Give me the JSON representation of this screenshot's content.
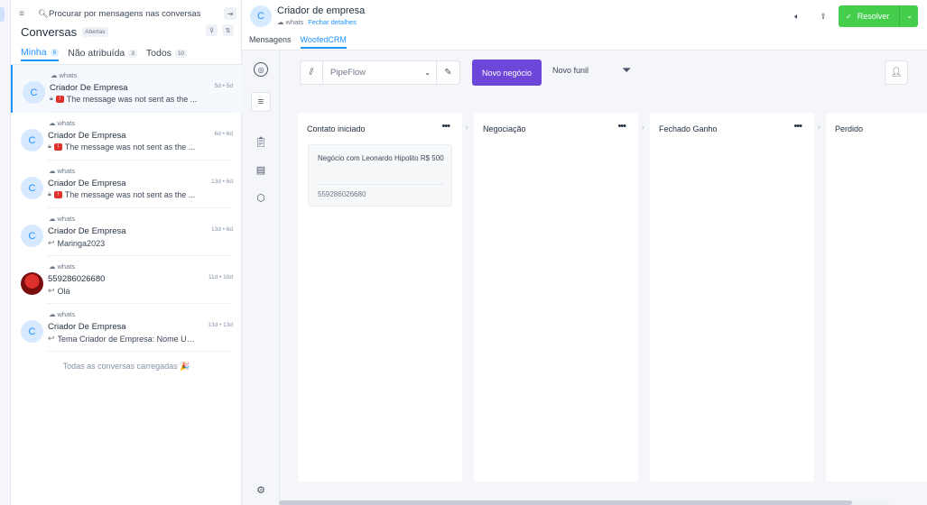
{
  "search": {
    "placeholder": "Procurar por mensagens nas conversas"
  },
  "conversations": {
    "title": "Conversas",
    "status_badge": "Abertas",
    "tabs": [
      {
        "label": "Minha",
        "count": "6"
      },
      {
        "label": "Não atribuída",
        "count": "3"
      },
      {
        "label": "Todos",
        "count": "10"
      }
    ],
    "items": [
      {
        "inbox": "whats",
        "name": "Criador De Empresa",
        "time": "5d • 5d",
        "message": "The message was not sent as the ...",
        "avatar": "C"
      },
      {
        "inbox": "whats",
        "name": "Criador De Empresa",
        "time": "6d • 6d",
        "message": "The message was not sent as the ...",
        "avatar": "C"
      },
      {
        "inbox": "whats",
        "name": "Criador De Empresa",
        "time": "13d • 6d",
        "message": "The message was not sent as the ...",
        "avatar": "C"
      },
      {
        "inbox": "whats",
        "name": "Criador De Empresa",
        "time": "13d • 6d",
        "message": "Maringa2023",
        "avatar": "C"
      },
      {
        "inbox": "whats",
        "name": "559286026680",
        "time": "11d • 10d",
        "message": "Olá",
        "avatar": ""
      },
      {
        "inbox": "whats",
        "name": "Criador De Empresa",
        "time": "13d • 13d",
        "message": "Tema Criador de Empresa: Nome Us...",
        "avatar": "C"
      }
    ],
    "loaded_message": "Todas as conversas carregadas 🎉"
  },
  "header": {
    "avatar": "C",
    "name": "Criador de empresa",
    "inbox": "whats",
    "details_link": "Fechar detalhes",
    "resolve_label": "Resolver"
  },
  "main_tabs": [
    {
      "label": "Mensagens"
    },
    {
      "label": "WoofedCRM"
    }
  ],
  "crm": {
    "pipeline": "PipeFlow",
    "new_deal_label": "Novo negócio",
    "new_funnel_label": "Novo funil",
    "stages": [
      {
        "name": "Contato iniciado",
        "deals": [
          {
            "title": "Negócio com Leonardo Hipolito R$ 500",
            "phone": "559286026680"
          }
        ]
      },
      {
        "name": "Negociação",
        "deals": []
      },
      {
        "name": "Fechado Ganho",
        "deals": []
      },
      {
        "name": "Perdido",
        "deals": []
      }
    ]
  },
  "colors": {
    "accent": "#1f93ff",
    "resolve": "#44ce4b",
    "primary_button": "#6c47d9",
    "error": "#e0302a"
  }
}
